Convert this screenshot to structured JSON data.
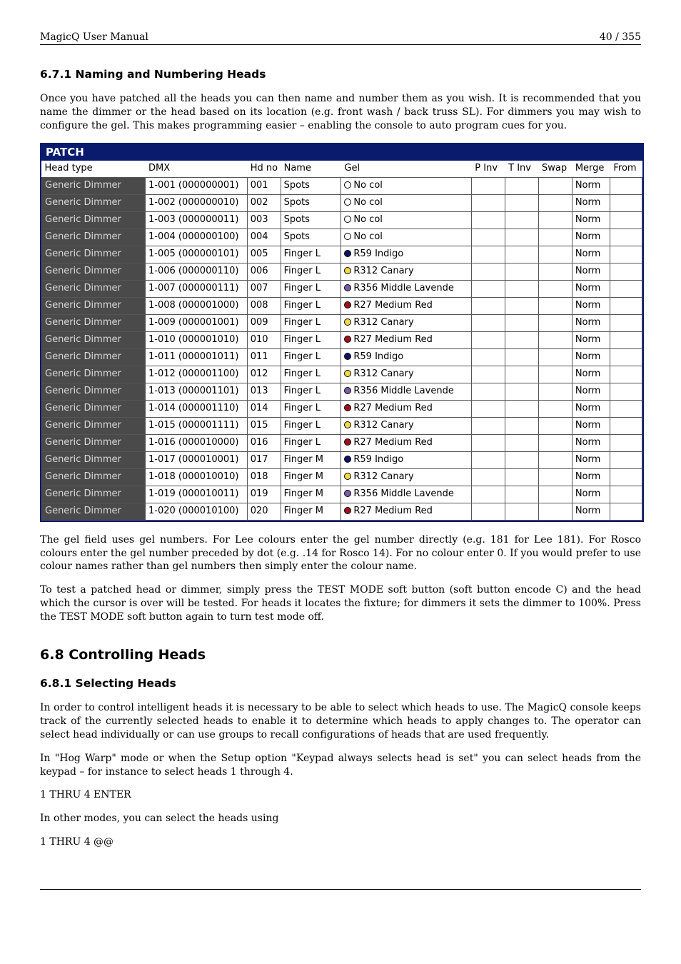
{
  "header": {
    "left": "MagicQ User Manual",
    "right": "40 / 355"
  },
  "s671": {
    "heading": "6.7.1   Naming and Numbering Heads",
    "para1": "Once you have patched all the heads you can then name and number them as you wish. It is recommended that you name the dimmer or the head based on its location (e.g. front wash / back truss SL). For dimmers you may wish to configure the gel. This makes programming easier – enabling the console to auto program cues for you."
  },
  "patch": {
    "title": "PATCH",
    "columns": [
      "Head type",
      "DMX",
      "Hd no",
      "Name",
      "Gel",
      "P Inv",
      "T Inv",
      "Swap",
      "Merge",
      "From"
    ],
    "rows": [
      {
        "head": "Generic Dimmer",
        "dmx": "1-001 (000000001)",
        "hdno": "001",
        "name": "Spots",
        "gelColor": "none",
        "gel": "No col",
        "merge": "Norm"
      },
      {
        "head": "Generic Dimmer",
        "dmx": "1-002 (000000010)",
        "hdno": "002",
        "name": "Spots",
        "gelColor": "none",
        "gel": "No col",
        "merge": "Norm"
      },
      {
        "head": "Generic Dimmer",
        "dmx": "1-003 (000000011)",
        "hdno": "003",
        "name": "Spots",
        "gelColor": "none",
        "gel": "No col",
        "merge": "Norm"
      },
      {
        "head": "Generic Dimmer",
        "dmx": "1-004 (000000100)",
        "hdno": "004",
        "name": "Spots",
        "gelColor": "none",
        "gel": "No col",
        "merge": "Norm"
      },
      {
        "head": "Generic Dimmer",
        "dmx": "1-005 (000000101)",
        "hdno": "005",
        "name": "Finger L",
        "gelColor": "#111166",
        "gel": "R59 Indigo",
        "merge": "Norm"
      },
      {
        "head": "Generic Dimmer",
        "dmx": "1-006 (000000110)",
        "hdno": "006",
        "name": "Finger L",
        "gelColor": "#f3d94a",
        "gel": "R312 Canary",
        "merge": "Norm"
      },
      {
        "head": "Generic Dimmer",
        "dmx": "1-007 (000000111)",
        "hdno": "007",
        "name": "Finger L",
        "gelColor": "#7a5ea8",
        "gel": "R356 Middle Lavende",
        "merge": "Norm"
      },
      {
        "head": "Generic Dimmer",
        "dmx": "1-008 (000001000)",
        "hdno": "008",
        "name": "Finger L",
        "gelColor": "#a0111e",
        "gel": "R27 Medium Red",
        "merge": "Norm"
      },
      {
        "head": "Generic Dimmer",
        "dmx": "1-009 (000001001)",
        "hdno": "009",
        "name": "Finger L",
        "gelColor": "#f3d94a",
        "gel": "R312 Canary",
        "merge": "Norm"
      },
      {
        "head": "Generic Dimmer",
        "dmx": "1-010 (000001010)",
        "hdno": "010",
        "name": "Finger L",
        "gelColor": "#a0111e",
        "gel": "R27 Medium Red",
        "merge": "Norm"
      },
      {
        "head": "Generic Dimmer",
        "dmx": "1-011 (000001011)",
        "hdno": "011",
        "name": "Finger L",
        "gelColor": "#111166",
        "gel": "R59 Indigo",
        "merge": "Norm"
      },
      {
        "head": "Generic Dimmer",
        "dmx": "1-012 (000001100)",
        "hdno": "012",
        "name": "Finger L",
        "gelColor": "#f3d94a",
        "gel": "R312 Canary",
        "merge": "Norm"
      },
      {
        "head": "Generic Dimmer",
        "dmx": "1-013 (000001101)",
        "hdno": "013",
        "name": "Finger L",
        "gelColor": "#7a5ea8",
        "gel": "R356 Middle Lavende",
        "merge": "Norm"
      },
      {
        "head": "Generic Dimmer",
        "dmx": "1-014 (000001110)",
        "hdno": "014",
        "name": "Finger L",
        "gelColor": "#a0111e",
        "gel": "R27 Medium Red",
        "merge": "Norm"
      },
      {
        "head": "Generic Dimmer",
        "dmx": "1-015 (000001111)",
        "hdno": "015",
        "name": "Finger L",
        "gelColor": "#f3d94a",
        "gel": "R312 Canary",
        "merge": "Norm"
      },
      {
        "head": "Generic Dimmer",
        "dmx": "1-016 (000010000)",
        "hdno": "016",
        "name": "Finger L",
        "gelColor": "#a0111e",
        "gel": "R27 Medium Red",
        "merge": "Norm"
      },
      {
        "head": "Generic Dimmer",
        "dmx": "1-017 (000010001)",
        "hdno": "017",
        "name": "Finger M",
        "gelColor": "#111166",
        "gel": "R59 Indigo",
        "merge": "Norm"
      },
      {
        "head": "Generic Dimmer",
        "dmx": "1-018 (000010010)",
        "hdno": "018",
        "name": "Finger M",
        "gelColor": "#f3d94a",
        "gel": "R312 Canary",
        "merge": "Norm"
      },
      {
        "head": "Generic Dimmer",
        "dmx": "1-019 (000010011)",
        "hdno": "019",
        "name": "Finger M",
        "gelColor": "#7a5ea8",
        "gel": "R356 Middle Lavende",
        "merge": "Norm"
      },
      {
        "head": "Generic Dimmer",
        "dmx": "1-020 (000010100)",
        "hdno": "020",
        "name": "Finger M",
        "gelColor": "#a0111e",
        "gel": "R27 Medium Red",
        "merge": "Norm"
      }
    ]
  },
  "afterPatch": {
    "p1": "The gel field uses gel numbers. For Lee colours enter the gel number directly (e.g. 181 for Lee 181). For Rosco colours enter the gel number preceded by dot (e.g. .14 for Rosco 14). For no colour enter 0. If you would prefer to use colour names rather than gel numbers then simply enter the colour name.",
    "p2": "To test a patched head or dimmer, simply press the TEST MODE soft button (soft button encode C) and the head which the cursor is over will be tested. For heads it locates the fixture; for dimmers it sets the dimmer to 100%. Press the TEST MODE soft button again to turn test mode off."
  },
  "s68": {
    "heading": "6.8   Controlling Heads"
  },
  "s681": {
    "heading": "6.8.1   Selecting Heads",
    "p1": "In order to control intelligent heads it is necessary to be able to select which heads to use. The MagicQ console keeps track of the currently selected heads to enable it to determine which heads to apply changes to. The operator can select head individually or can use groups to recall configurations of heads that are used frequently.",
    "p2": "In \"Hog Warp\" mode or when the Setup option \"Keypad always selects head is set\" you can select heads from the keypad – for instance to select heads 1 through 4.",
    "l1": "1 THRU 4 ENTER",
    "p3": "In other modes, you can select the heads using",
    "l2": "1 THRU 4 @@"
  }
}
